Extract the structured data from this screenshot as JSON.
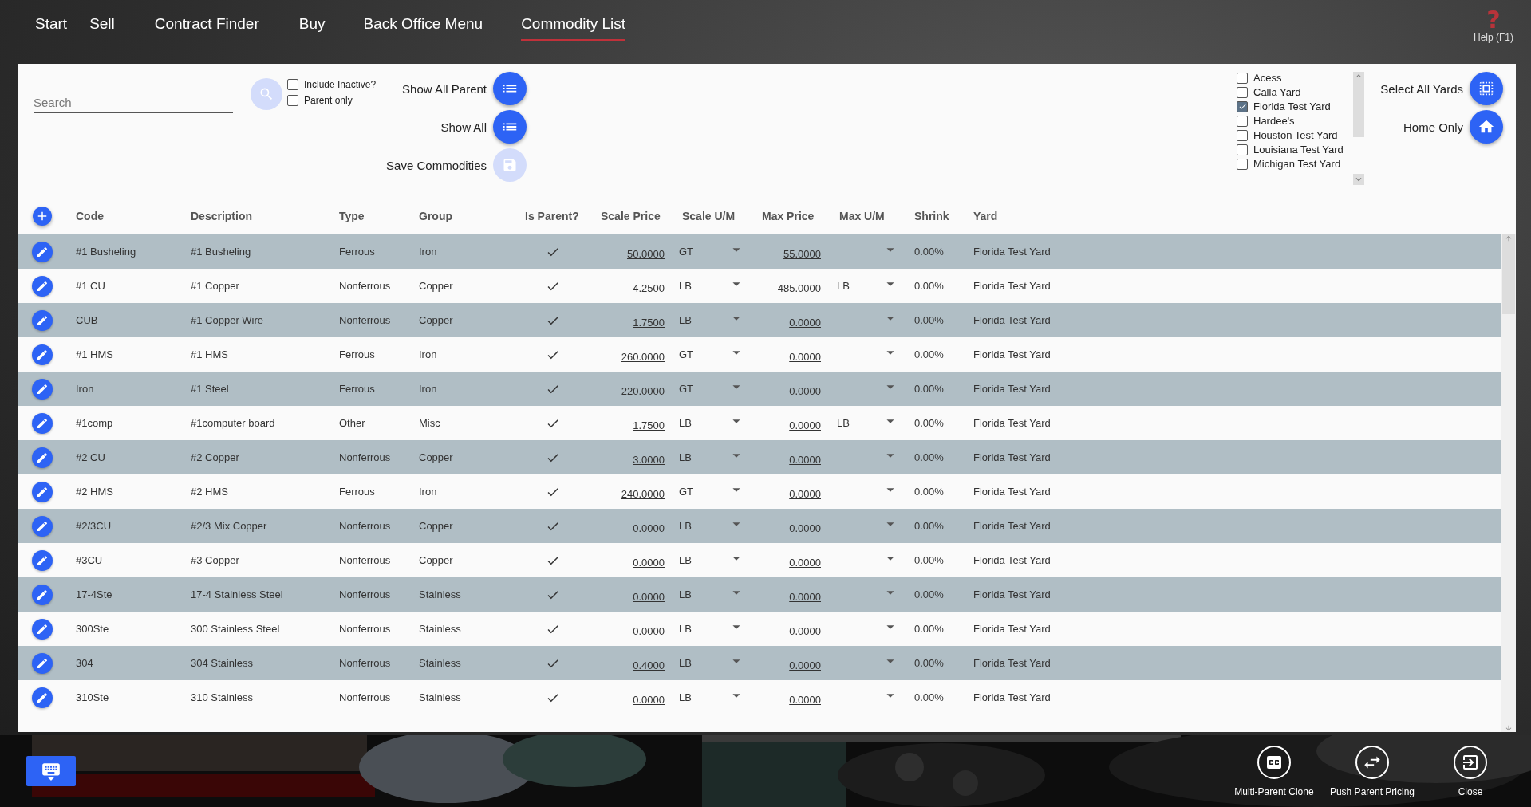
{
  "tabs": [
    {
      "label": "Start",
      "selected": false
    },
    {
      "label": "Sell",
      "selected": false
    },
    {
      "label": "Contract Finder",
      "selected": false
    },
    {
      "label": "Buy",
      "selected": false
    },
    {
      "label": "Back Office Menu",
      "selected": false
    },
    {
      "label": "Commodity List",
      "selected": true
    }
  ],
  "help": {
    "icon": "?",
    "label": "Help (F1)"
  },
  "search": {
    "placeholder": "Search"
  },
  "filters": [
    {
      "label": "Include Inactive?",
      "checked": false
    },
    {
      "label": "Parent only",
      "checked": false
    }
  ],
  "actions": [
    {
      "label": "Show All Parent",
      "kind": "list",
      "disabled": false
    },
    {
      "label": "Show All",
      "kind": "list",
      "disabled": false
    },
    {
      "label": "Save Commodities",
      "kind": "save",
      "disabled": true
    }
  ],
  "yards": [
    {
      "label": "Acess",
      "checked": false
    },
    {
      "label": "Calla Yard",
      "checked": false
    },
    {
      "label": "Florida Test Yard",
      "checked": true
    },
    {
      "label": "Hardee's",
      "checked": false
    },
    {
      "label": "Houston Test Yard",
      "checked": false
    },
    {
      "label": "Louisiana Test Yard",
      "checked": false
    },
    {
      "label": "Michigan Test Yard",
      "checked": false
    }
  ],
  "yard_actions": [
    {
      "label": "Select All Yards",
      "kind": "select"
    },
    {
      "label": "Home Only",
      "kind": "home"
    }
  ],
  "table": {
    "columns": [
      "Code",
      "Description",
      "Type",
      "Group",
      "Is Parent?",
      "Scale Price",
      "Scale U/M",
      "Max Price",
      "Max U/M",
      "Shrink",
      "Yard"
    ],
    "rows": [
      {
        "code": "#1 Busheling",
        "description": "#1 Busheling",
        "type": "Ferrous",
        "group": "Iron",
        "is_parent": true,
        "scale_price": "50.0000",
        "scale_um": "GT",
        "max_price": "55.0000",
        "shrink": "0.00%",
        "yard": "Florida Test Yard"
      },
      {
        "code": "#1 CU",
        "description": "#1 Copper",
        "type": "Nonferrous",
        "group": "Copper",
        "is_parent": true,
        "scale_price": "4.2500",
        "scale_um": "LB",
        "max_price": "485.0000",
        "max_um": "LB",
        "shrink": "0.00%",
        "yard": "Florida Test Yard"
      },
      {
        "code": "CUB",
        "description": "#1 Copper Wire",
        "type": "Nonferrous",
        "group": "Copper",
        "is_parent": true,
        "scale_price": "1.7500",
        "scale_um": "LB",
        "max_price": "0.0000",
        "shrink": "0.00%",
        "yard": "Florida Test Yard"
      },
      {
        "code": "#1 HMS",
        "description": "#1 HMS",
        "type": "Ferrous",
        "group": "Iron",
        "is_parent": true,
        "scale_price": "260.0000",
        "scale_um": "GT",
        "max_price": "0.0000",
        "shrink": "0.00%",
        "yard": "Florida Test Yard"
      },
      {
        "code": "Iron",
        "description": "#1 Steel",
        "type": "Ferrous",
        "group": "Iron",
        "is_parent": true,
        "scale_price": "220.0000",
        "scale_um": "GT",
        "max_price": "0.0000",
        "shrink": "0.00%",
        "yard": "Florida Test Yard"
      },
      {
        "code": "#1comp",
        "description": "#1computer board",
        "type": "Other",
        "group": "Misc",
        "is_parent": true,
        "scale_price": "1.7500",
        "scale_um": "LB",
        "max_price": "0.0000",
        "max_um": "LB",
        "shrink": "0.00%",
        "yard": "Florida Test Yard"
      },
      {
        "code": "#2 CU",
        "description": "#2 Copper",
        "type": "Nonferrous",
        "group": "Copper",
        "is_parent": true,
        "scale_price": "3.0000",
        "scale_um": "LB",
        "max_price": "0.0000",
        "shrink": "0.00%",
        "yard": "Florida Test Yard"
      },
      {
        "code": "#2 HMS",
        "description": "#2 HMS",
        "type": "Ferrous",
        "group": "Iron",
        "is_parent": true,
        "scale_price": "240.0000",
        "scale_um": "GT",
        "max_price": "0.0000",
        "shrink": "0.00%",
        "yard": "Florida Test Yard"
      },
      {
        "code": "#2/3CU",
        "description": "#2/3 Mix Copper",
        "type": "Nonferrous",
        "group": "Copper",
        "is_parent": true,
        "scale_price": "0.0000",
        "scale_um": "LB",
        "max_price": "0.0000",
        "shrink": "0.00%",
        "yard": "Florida Test Yard"
      },
      {
        "code": "#3CU",
        "description": "#3 Copper",
        "type": "Nonferrous",
        "group": "Copper",
        "is_parent": true,
        "scale_price": "0.0000",
        "scale_um": "LB",
        "max_price": "0.0000",
        "shrink": "0.00%",
        "yard": "Florida Test Yard"
      },
      {
        "code": "17-4Ste",
        "description": "17-4 Stainless Steel",
        "type": "Nonferrous",
        "group": "Stainless",
        "is_parent": true,
        "scale_price": "0.0000",
        "scale_um": "LB",
        "max_price": "0.0000",
        "shrink": "0.00%",
        "yard": "Florida Test Yard"
      },
      {
        "code": "300Ste",
        "description": "300 Stainless Steel",
        "type": "Nonferrous",
        "group": "Stainless",
        "is_parent": true,
        "scale_price": "0.0000",
        "scale_um": "LB",
        "max_price": "0.0000",
        "shrink": "0.00%",
        "yard": "Florida Test Yard"
      },
      {
        "code": "304",
        "description": "304 Stainless",
        "type": "Nonferrous",
        "group": "Stainless",
        "is_parent": true,
        "scale_price": "0.4000",
        "scale_um": "LB",
        "max_price": "0.0000",
        "shrink": "0.00%",
        "yard": "Florida Test Yard"
      },
      {
        "code": "310Ste",
        "description": "310 Stainless",
        "type": "Nonferrous",
        "group": "Stainless",
        "is_parent": true,
        "scale_price": "0.0000",
        "scale_um": "LB",
        "max_price": "0.0000",
        "shrink": "0.00%",
        "yard": "Florida Test Yard"
      }
    ]
  },
  "footer_actions": [
    {
      "label": "Multi-Parent Clone",
      "kind": "clone"
    },
    {
      "label": "Push Parent Pricing",
      "kind": "push"
    },
    {
      "label": "Close",
      "kind": "close"
    }
  ]
}
